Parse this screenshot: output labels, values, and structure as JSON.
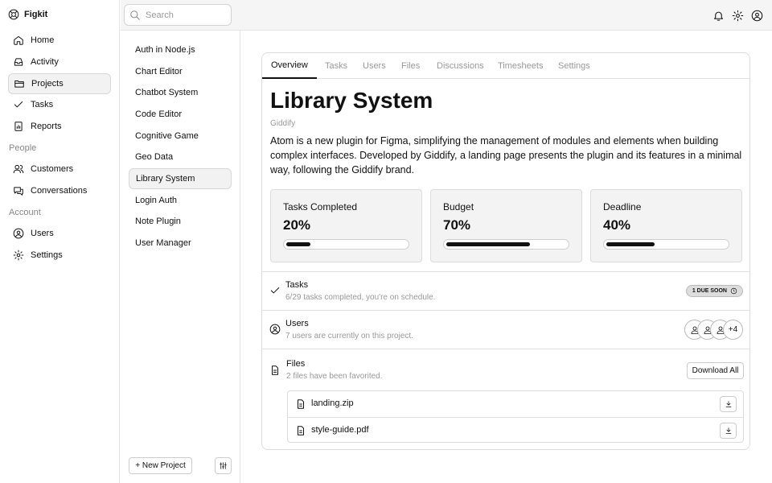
{
  "app": {
    "name": "Figkit",
    "logo_icon": "lifebuoy-icon"
  },
  "sidebar": {
    "items": [
      {
        "label": "Home",
        "icon": "home-icon"
      },
      {
        "label": "Activity",
        "icon": "inbox-icon"
      },
      {
        "label": "Projects",
        "icon": "folder-icon",
        "active": true
      },
      {
        "label": "Tasks",
        "icon": "check-icon"
      },
      {
        "label": "Reports",
        "icon": "report-icon"
      }
    ],
    "people_section": "People",
    "people_items": [
      {
        "label": "Customers",
        "icon": "users-icon"
      },
      {
        "label": "Conversations",
        "icon": "chat-icon"
      }
    ],
    "account_section": "Account",
    "account_items": [
      {
        "label": "Users",
        "icon": "user-circle-icon"
      },
      {
        "label": "Settings",
        "icon": "gear-icon"
      }
    ]
  },
  "topbar": {
    "search_placeholder": "Search",
    "icons": [
      "bell-icon",
      "gear-icon",
      "user-circle-icon"
    ]
  },
  "projects": {
    "items": [
      "Auth in Node.js",
      "Chart Editor",
      "Chatbot System",
      "Code Editor",
      "Cognitive Game",
      "Geo Data",
      "Library System",
      "Login Auth",
      "Note Plugin",
      "User Manager"
    ],
    "active": "Library System",
    "new_label": "+ New Project"
  },
  "main": {
    "tabs": [
      "Overview",
      "Tasks",
      "Users",
      "Files",
      "Discussions",
      "Timesheets",
      "Settings"
    ],
    "active_tab": "Overview",
    "title": "Library System",
    "subtitle": "Giddify",
    "description": "Atom is a new plugin for Figma, simplifying the management of modules and elements when building complex interfaces. Developed by Giddify, a landing page presents the plugin and its features in a minimal way, following the Giddify brand.",
    "stats": [
      {
        "label": "Tasks Completed",
        "value": "20%",
        "progress": 0.2
      },
      {
        "label": "Budget",
        "value": "70%",
        "progress": 0.7
      },
      {
        "label": "Deadline",
        "value": "40%",
        "progress": 0.4
      }
    ],
    "tasks": {
      "title": "Tasks",
      "subtitle": "6/29 tasks completed, you're on schedule.",
      "badge": "1 DUE SOON"
    },
    "users": {
      "title": "Users",
      "subtitle": "7 users are currently on this project.",
      "extra": "+4"
    },
    "files": {
      "title": "Files",
      "subtitle": "2 files have been favorited.",
      "download_all": "Download All",
      "list": [
        "landing.zip",
        "style-guide.pdf"
      ]
    }
  }
}
